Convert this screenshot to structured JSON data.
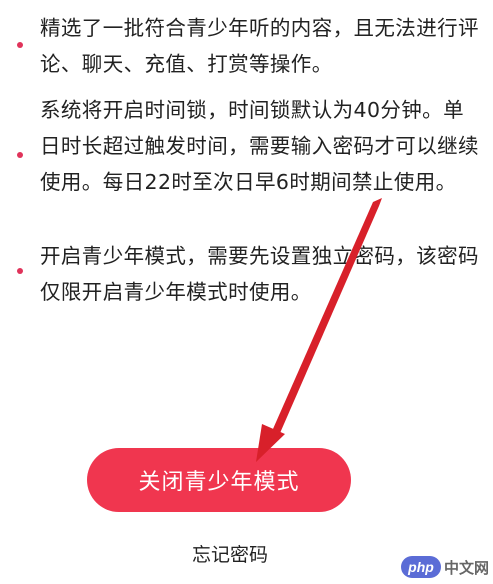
{
  "colors": {
    "accent": "#F0364F",
    "bullet": "#E0335A",
    "arrow": "#D8202A",
    "watermark_logo_bg": "#5B6CD6",
    "watermark_text": "#666666"
  },
  "notes": [
    {
      "text": "精选了一批符合青少年听的内容，且无法进行评论、聊天、充值、打赏等操作。"
    },
    {
      "text": "系统将开启时间锁，时间锁默认为40分钟。单日时长超过触发时间，需要输入密码才可以继续使用。每日22时至次日早6时期间禁止使用。"
    },
    {
      "text": "开启青少年模式，需要先设置独立密码，该密码仅限开启青少年模式时使用。"
    }
  ],
  "actions": {
    "close_mode_label": "关闭青少年模式",
    "forgot_password_label": "忘记密码"
  },
  "watermark": {
    "logo_text": "php",
    "site_text": "中文网"
  },
  "annotation": {
    "arrow": "red-arrow-pointing-to-close-button"
  }
}
